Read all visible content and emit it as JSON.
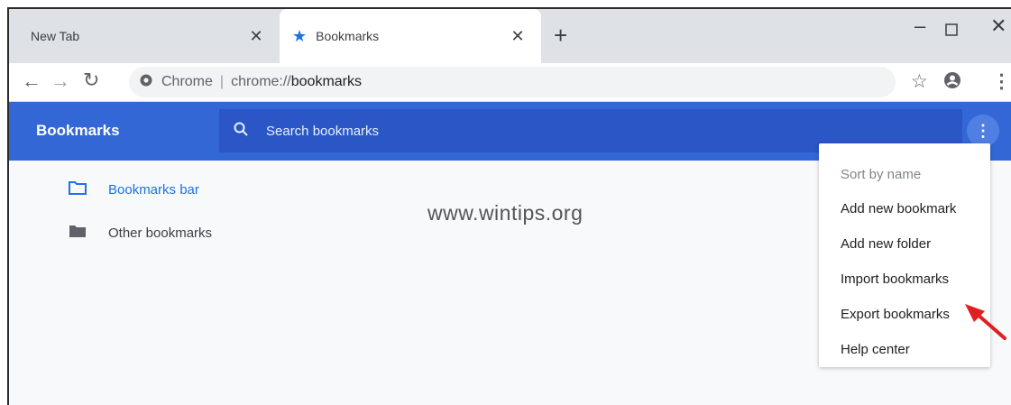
{
  "tabs": [
    {
      "title": "New Tab",
      "active": false
    },
    {
      "title": "Bookmarks",
      "active": true
    }
  ],
  "toolbar": {
    "site_chip": "Chrome",
    "url_scheme": "chrome://",
    "url_host": "bookmarks"
  },
  "app": {
    "title": "Bookmarks",
    "search_placeholder": "Search bookmarks"
  },
  "folders": [
    {
      "label": "Bookmarks bar",
      "active": true
    },
    {
      "label": "Other bookmarks",
      "active": false
    }
  ],
  "watermark": "www.wintips.org",
  "menu": {
    "items": [
      {
        "label": "Sort by name",
        "disabled": true
      },
      {
        "label": "Add new bookmark"
      },
      {
        "label": "Add new folder"
      },
      {
        "label": "Import bookmarks"
      },
      {
        "label": "Export bookmarks"
      },
      {
        "label": "Help center"
      }
    ]
  },
  "colors": {
    "header_blue": "#3367d6",
    "search_blue": "#2a56c6",
    "link_blue": "#1a73e8",
    "arrow_red": "#e02020"
  },
  "icons": [
    "close-icon",
    "star-icon",
    "plus-icon",
    "minimize-icon",
    "maximize-icon",
    "window-close-icon",
    "back-arrow-icon",
    "forward-arrow-icon",
    "reload-icon",
    "chrome-icon",
    "bookmark-star-icon",
    "profile-icon",
    "more-vert-icon",
    "search-icon",
    "folder-outline-icon",
    "folder-filled-icon",
    "red-arrow-icon"
  ]
}
